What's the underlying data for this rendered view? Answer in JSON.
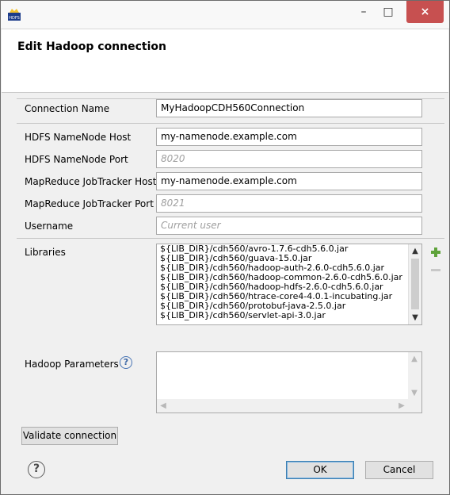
{
  "window": {
    "app_icon_label": "HDFS",
    "minimize_glyph": "–",
    "maximize_glyph": "□",
    "close_glyph": "×"
  },
  "banner": {
    "title": "Edit Hadoop connection"
  },
  "form": {
    "connection_name": {
      "label": "Connection Name",
      "value": "MyHadoopCDH560Connection",
      "placeholder": ""
    },
    "namenode_host": {
      "label": "HDFS NameNode Host",
      "value": "my-namenode.example.com",
      "placeholder": ""
    },
    "namenode_port": {
      "label": "HDFS NameNode Port",
      "value": "",
      "placeholder": "8020"
    },
    "jobtracker_host": {
      "label": "MapReduce JobTracker Host",
      "value": "my-namenode.example.com",
      "placeholder": ""
    },
    "jobtracker_port": {
      "label": "MapReduce JobTracker Port",
      "value": "",
      "placeholder": "8021"
    },
    "username": {
      "label": "Username",
      "value": "",
      "placeholder": "Current user"
    }
  },
  "libraries": {
    "label": "Libraries",
    "items": [
      "${LIB_DIR}/cdh560/avro-1.7.6-cdh5.6.0.jar",
      "${LIB_DIR}/cdh560/guava-15.0.jar",
      "${LIB_DIR}/cdh560/hadoop-auth-2.6.0-cdh5.6.0.jar",
      "${LIB_DIR}/cdh560/hadoop-common-2.6.0-cdh5.6.0.jar",
      "${LIB_DIR}/cdh560/hadoop-hdfs-2.6.0-cdh5.6.0.jar",
      "${LIB_DIR}/cdh560/htrace-core4-4.0.1-incubating.jar",
      "${LIB_DIR}/cdh560/protobuf-java-2.5.0.jar",
      "${LIB_DIR}/cdh560/servlet-api-3.0.jar"
    ],
    "add_icon": "plus-icon",
    "remove_icon": "minus-icon"
  },
  "parameters": {
    "label": "Hadoop Parameters",
    "help_glyph": "?"
  },
  "buttons": {
    "validate": "Validate connection",
    "ok": "OK",
    "cancel": "Cancel",
    "help_glyph": "?"
  },
  "colors": {
    "close_button": "#c75050",
    "plus_icon": "#5fa33b",
    "help_blue": "#3a66a5"
  }
}
